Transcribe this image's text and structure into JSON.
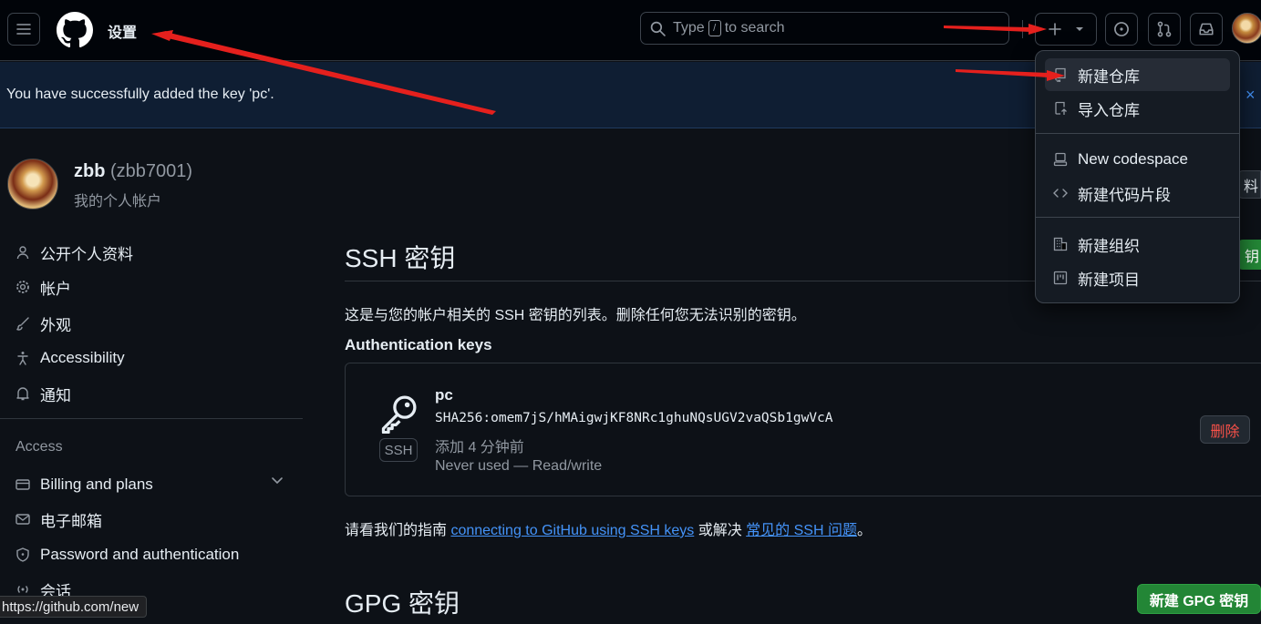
{
  "header": {
    "page_context": "设置",
    "search": {
      "prefix": "Type",
      "key": "/",
      "suffix": "to search"
    }
  },
  "flash": {
    "message": "You have successfully added the key 'pc'.",
    "close": "×"
  },
  "user": {
    "name": "zbb",
    "login": "(zbb7001)",
    "subtitle": "我的个人帐户"
  },
  "sidebar": {
    "items": [
      {
        "label": "公开个人资料",
        "icon": "person-icon"
      },
      {
        "label": "帐户",
        "icon": "gear-icon"
      },
      {
        "label": "外观",
        "icon": "paintbrush-icon"
      },
      {
        "label": "Accessibility",
        "icon": "accessibility-icon"
      },
      {
        "label": "通知",
        "icon": "bell-icon"
      }
    ],
    "access_heading": "Access",
    "access_items": [
      {
        "label": "Billing and plans",
        "icon": "credit-card-icon"
      },
      {
        "label": "电子邮箱",
        "icon": "mail-icon"
      },
      {
        "label": "Password and authentication",
        "icon": "shield-lock-icon"
      },
      {
        "label": "会话",
        "icon": "broadcast-icon"
      }
    ]
  },
  "main": {
    "ssh_heading": "SSH 密钥",
    "description": "这是与您的帐户相关的 SSH 密钥的列表。删除任何您无法识别的密钥。",
    "auth_heading": "Authentication keys",
    "key": {
      "title": "pc",
      "fingerprint": "SHA256:omem7jS/hMAigwjKF8NRc1ghuNQsUGV2vaQSb1gwVcA",
      "added": "添加 4 分钟前",
      "usage": "Never used — Read/write",
      "badge": "SSH",
      "delete_label": "删除"
    },
    "guide": {
      "prefix": "请看我们的指南 ",
      "link1": "connecting to GitHub using SSH keys",
      "middle": " 或解决 ",
      "link2": "常见的 SSH 问题",
      "suffix": "。"
    },
    "gpg_heading": "GPG 密钥",
    "gpg_button": "新建 GPG 密钥",
    "edge_green": "钥",
    "edge_grey": "料"
  },
  "create_menu": {
    "items": [
      {
        "label": "新建仓库",
        "icon": "repo-icon"
      },
      {
        "label": "导入仓库",
        "icon": "repo-push-icon"
      },
      {
        "label": "New codespace",
        "icon": "codespaces-icon"
      },
      {
        "label": "新建代码片段",
        "icon": "code-icon"
      },
      {
        "label": "新建组织",
        "icon": "organization-icon"
      },
      {
        "label": "新建项目",
        "icon": "project-icon"
      }
    ]
  },
  "status_bar": {
    "url": "https://github.com/new"
  },
  "colors": {
    "accent": "#4493f8",
    "danger": "#f85149",
    "success": "#238636",
    "annotation": "#e5201d"
  }
}
